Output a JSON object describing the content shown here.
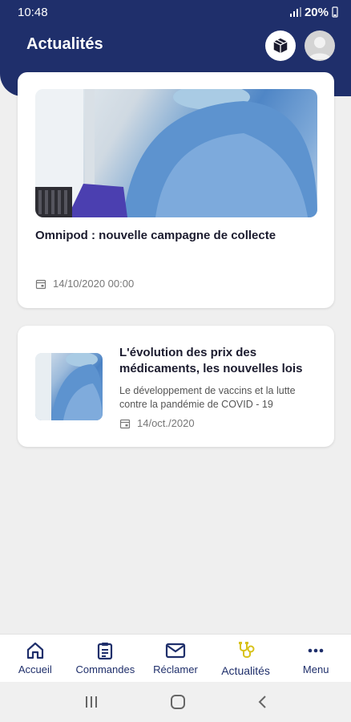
{
  "status_bar": {
    "time": "10:48",
    "battery": "20%"
  },
  "header": {
    "title": "Actualités"
  },
  "articles": [
    {
      "title": "Omnipod : nouvelle campagne de collecte",
      "date": "14/10/2020 00:00"
    },
    {
      "title": "L'évolution des prix des médicaments, les nouvelles lois",
      "description": "Le développement de vaccins et la lutte contre la pandémie de COVID - 19",
      "date": "14/oct./2020"
    }
  ],
  "bottom_nav": [
    {
      "label": "Accueil",
      "icon": "home-icon"
    },
    {
      "label": "Commandes",
      "icon": "clipboard-icon"
    },
    {
      "label": "Réclamer",
      "icon": "mail-icon"
    },
    {
      "label": "Actualités",
      "icon": "stethoscope-icon",
      "active": true
    },
    {
      "label": "Menu",
      "icon": "more-icon"
    }
  ],
  "colors": {
    "primary": "#1f2f6b",
    "active_icon": "#d8c21a",
    "background": "#efefef"
  }
}
